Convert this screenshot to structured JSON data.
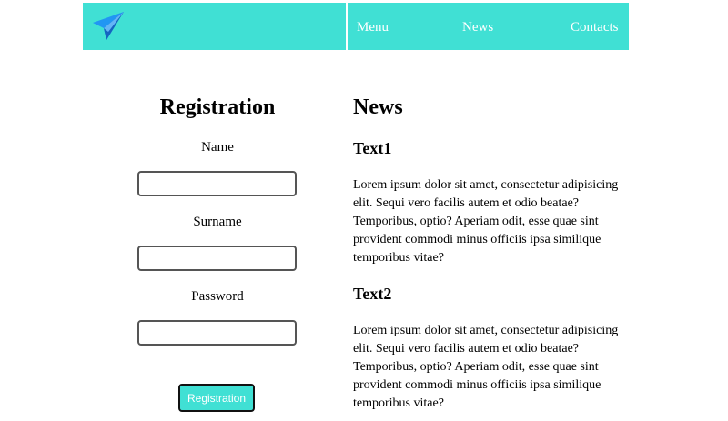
{
  "header": {
    "logo_icon": "paper-plane-icon",
    "nav": [
      {
        "label": "Menu"
      },
      {
        "label": "News"
      },
      {
        "label": "Contacts"
      }
    ],
    "accent_color": "#40e0d4"
  },
  "registration": {
    "title": "Registration",
    "fields": [
      {
        "label": "Name",
        "value": ""
      },
      {
        "label": "Surname",
        "value": ""
      },
      {
        "label": "Password",
        "value": ""
      }
    ],
    "button_label": "Registration"
  },
  "news": {
    "title": "News",
    "articles": [
      {
        "title": "Text1",
        "body": "Lorem ipsum dolor sit amet, consectetur adipisicing elit. Sequi vero facilis autem et odio beatae? Temporibus, optio? Aperiam odit, esse quae sint provident commodi minus officiis ipsa similique temporibus vitae?"
      },
      {
        "title": "Text2",
        "body": "Lorem ipsum dolor sit amet, consectetur adipisicing elit. Sequi vero facilis autem et odio beatae? Temporibus, optio? Aperiam odit, esse quae sint provident commodi minus officiis ipsa similique temporibus vitae?"
      }
    ]
  }
}
